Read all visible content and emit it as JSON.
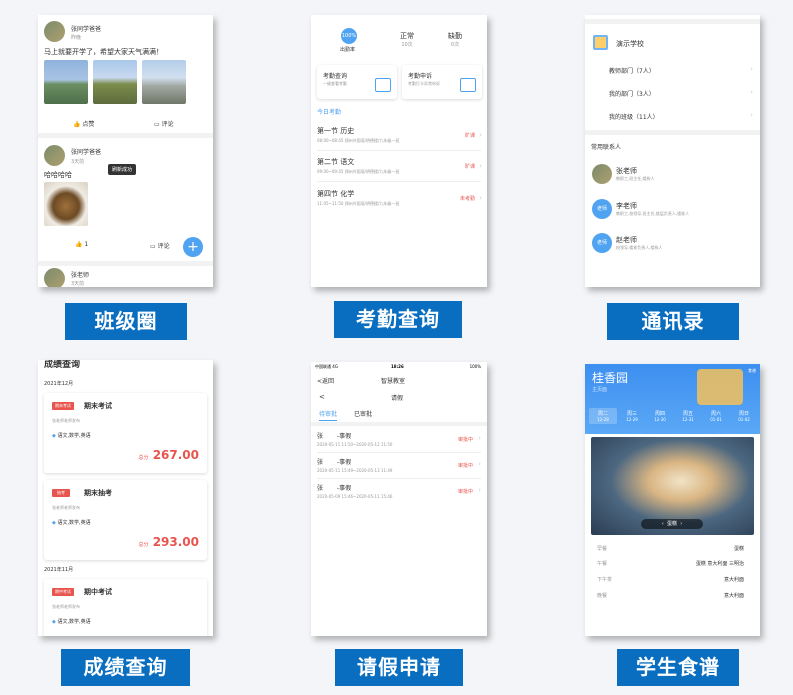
{
  "captions": [
    "班级圈",
    "考勤查询",
    "通讯录",
    "成绩查询",
    "请假申请",
    "学生食谱"
  ],
  "class_circle": {
    "post1": {
      "user": "张同学爸爸",
      "sub": "昨晚",
      "text": "马上就要开学了，希望大家天气满满！",
      "like": "点赞",
      "comment": "评论"
    },
    "post2": {
      "user": "张同学爸爸",
      "sub": "3天前",
      "text": "哈哈哈哈",
      "toast": "刷新成功",
      "likes": "1",
      "comment": "评论",
      "fab": "+"
    },
    "post3": {
      "user": "张老师",
      "sub": "3天前"
    }
  },
  "attendance": {
    "ring": "100%",
    "ring_label": "出勤率",
    "stats": [
      {
        "label": "正常",
        "value": "10次"
      },
      {
        "label": "缺勤",
        "value": "0次"
      }
    ],
    "cards": [
      {
        "title": "考勤查询",
        "sub": "一键查看考勤"
      },
      {
        "title": "考勤申诉",
        "sub": "考勤打卡异常申诉"
      }
    ],
    "today": "今日考勤",
    "items": [
      {
        "title": "第一节 历史",
        "sub": "08:00~08:45 郑州外国语/明德楼/九年级一班",
        "status": "旷课"
      },
      {
        "title": "第二节 语文",
        "sub": "09:00~09:45 郑州外国语/明德楼/九年级一班",
        "status": "旷课"
      },
      {
        "title": "第四节 化学",
        "sub": "11:05~11:50 郑州外国语/明德楼/九年级一班",
        "status": "未考勤"
      }
    ]
  },
  "contacts": {
    "school": "演示学校",
    "groups": [
      "教师部门（7人）",
      "我的部门（3人）",
      "我的班级（11人）"
    ],
    "frequent": "常用联系人",
    "people": [
      {
        "name": "张老师",
        "role": "教职工,班主任,楼栋人",
        "avatar": ""
      },
      {
        "name": "李老师",
        "role": "教职工,校领导,班主任,楼层负责人,楼栋人",
        "avatar": "老师"
      },
      {
        "name": "赵老师",
        "role": "校领导,楼栋负责人,楼栋人",
        "avatar": "老师"
      }
    ]
  },
  "grades": {
    "header": "成绩查询",
    "sections": [
      {
        "month": "2021年12月",
        "exams": [
          {
            "badge": "期末考试",
            "title": "期末考试",
            "by": "张老师老师发布",
            "subjects": "语文,数学,英语",
            "total_label": "总分",
            "score": "267.00"
          },
          {
            "badge": "抽考",
            "title": "期末抽考",
            "by": "张老师老师发布",
            "subjects": "语文,数学,英语",
            "total_label": "总分",
            "score": "293.00"
          }
        ]
      },
      {
        "month": "2021年11月",
        "exams": [
          {
            "badge": "期中考试",
            "title": "期中考试",
            "by": "张老师老师发布",
            "subjects": "语文,数学,英语"
          }
        ]
      }
    ]
  },
  "leave": {
    "status_bar": {
      "carrier": "中国联通",
      "net": "4G",
      "time": "18:26",
      "battery": "100%"
    },
    "back": "返回",
    "app_title": "智慧教室",
    "page_title": "请假",
    "tabs": [
      "待审批",
      "已审批"
    ],
    "items": [
      {
        "title": "张　　 -事假",
        "time": "2020-05-11 11:50~2020-05-12 11:50",
        "status": "审批中"
      },
      {
        "title": "张　　 -事假",
        "time": "2020-05-11 15:49~2020-05-13 11:49",
        "status": "审批中"
      },
      {
        "title": "张　　 -事假",
        "time": "2020-05-09 15:46~2020-05-11 15:46",
        "status": "审批中"
      }
    ]
  },
  "menu": {
    "school": "桂香园",
    "sub": "主页面",
    "corner": "食谱",
    "days": [
      {
        "d": "周二",
        "date": "12-28"
      },
      {
        "d": "周三",
        "date": "12-29"
      },
      {
        "d": "周四",
        "date": "12-30"
      },
      {
        "d": "周五",
        "date": "12-31"
      },
      {
        "d": "周六",
        "date": "01-01"
      },
      {
        "d": "周日",
        "date": "01-02"
      }
    ],
    "dish_label": "蛋糕",
    "meals": [
      {
        "meal": "早餐",
        "food": "蛋糕"
      },
      {
        "meal": "午餐",
        "food": "蛋糕 意大利面 三明治"
      },
      {
        "meal": "下午茶",
        "food": "意大利面"
      },
      {
        "meal": "晚餐",
        "food": "意大利面"
      }
    ]
  }
}
